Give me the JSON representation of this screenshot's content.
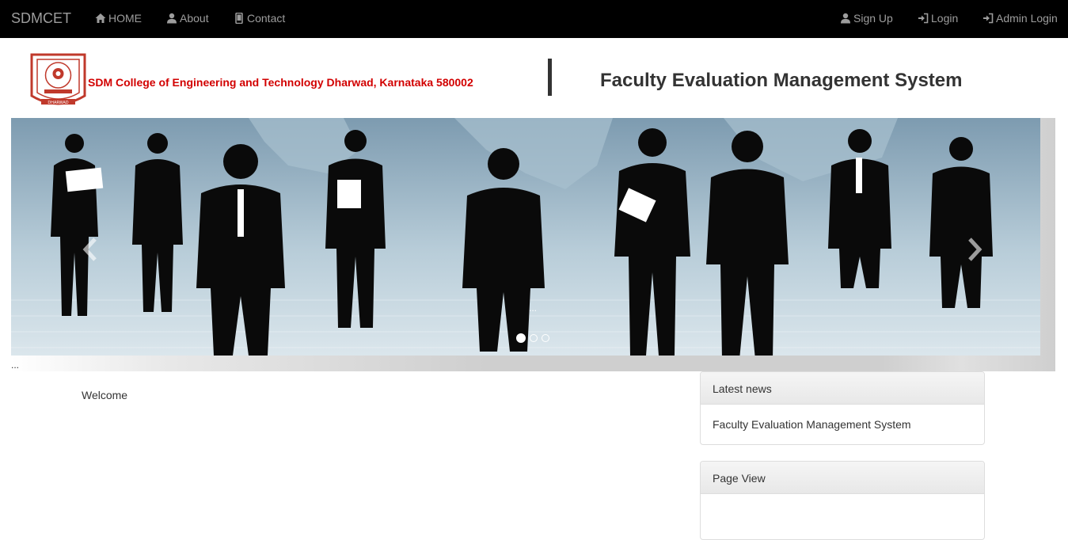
{
  "navbar": {
    "brand": "SDMCET",
    "left_items": [
      {
        "label": "HOME",
        "icon": "home-icon"
      },
      {
        "label": "About",
        "icon": "user-icon"
      },
      {
        "label": "Contact",
        "icon": "phone-icon"
      }
    ],
    "right_items": [
      {
        "label": "Sign Up",
        "icon": "user-icon"
      },
      {
        "label": "Login",
        "icon": "login-icon"
      },
      {
        "label": "Admin Login",
        "icon": "login-icon"
      }
    ]
  },
  "header": {
    "college_name": "SDM College of Engineering and Technology Dharwad, Karnataka 580002",
    "system_title": "Faculty Evaluation Management System",
    "logo_text": "DHARWAD"
  },
  "carousel": {
    "caption": "...",
    "footer_text": "...",
    "slide_count": 3,
    "active_slide": 1
  },
  "main": {
    "welcome": "Welcome"
  },
  "sidebar": {
    "news_heading": "Latest news",
    "news_item": "Faculty Evaluation Management System",
    "pageview_heading": "Page View"
  },
  "colors": {
    "navbar_bg": "#000000",
    "nav_text": "#9d9d9d",
    "college_red": "#d20000"
  }
}
